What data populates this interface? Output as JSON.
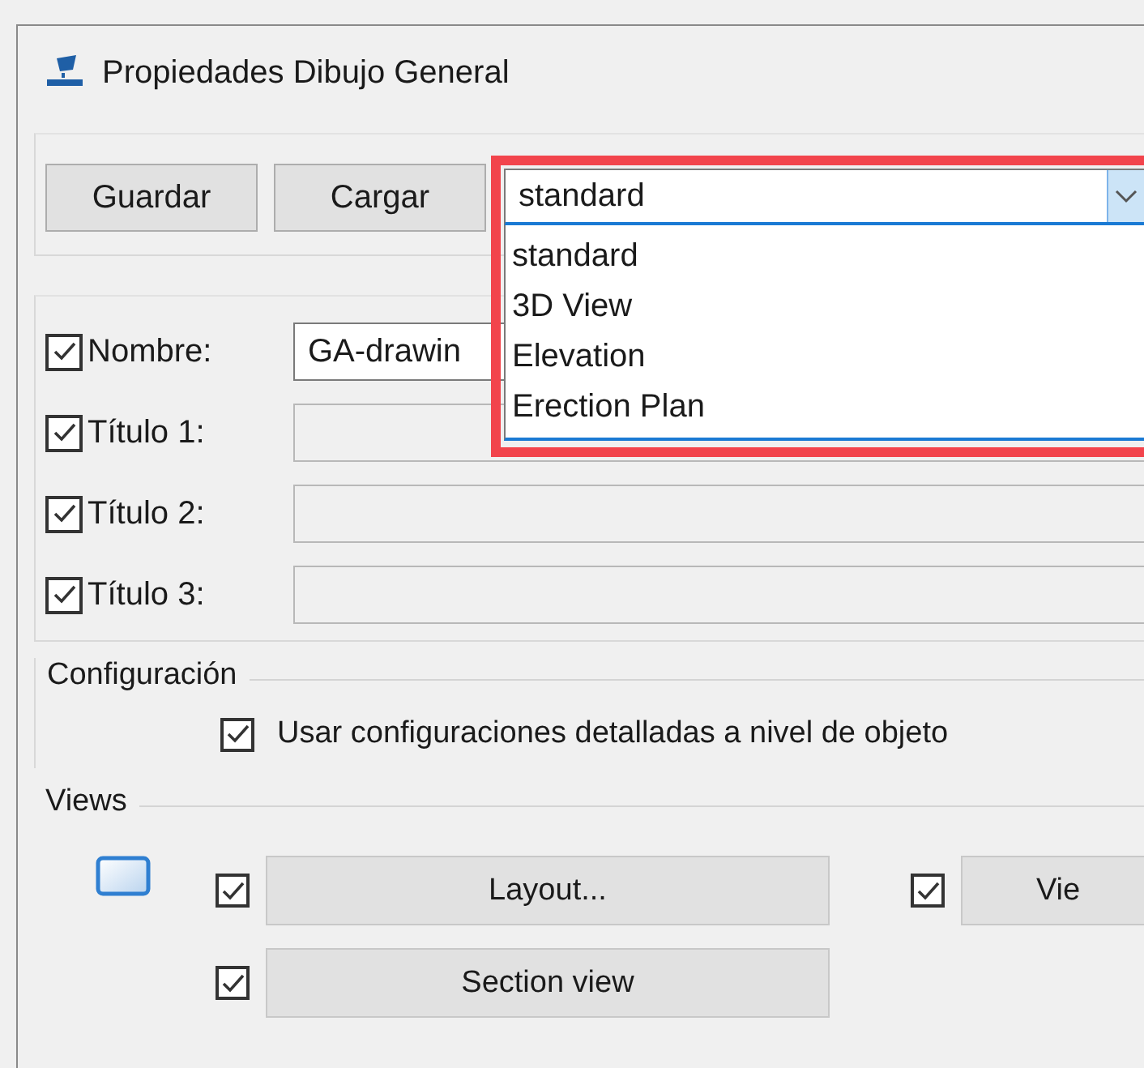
{
  "window": {
    "title": "Propiedades Dibujo General"
  },
  "toolbar": {
    "buttons": [
      "Guardar",
      "Cargar"
    ],
    "combo": {
      "value": "standard",
      "expanded": true,
      "options": [
        {
          "label": "standard"
        },
        {
          "label": "3D View"
        },
        {
          "label": "Elevation"
        },
        {
          "label": "Erection Plan"
        }
      ]
    }
  },
  "fields": [
    {
      "label": "Nombre:",
      "checked": true,
      "value": "GA-drawin",
      "disabled": false
    },
    {
      "label": "Título 1:",
      "checked": true,
      "disabled": true
    },
    {
      "label": "Título 2:",
      "checked": true,
      "disabled": true
    },
    {
      "label": "Título 3:",
      "checked": true,
      "disabled": true
    }
  ],
  "configuracion": {
    "title": "Configuración",
    "option": {
      "label": "Usar configuraciones detalladas a nivel de objeto",
      "checked": true
    }
  },
  "views": {
    "title": "Views",
    "rows": [
      [
        {
          "label": "Layout...",
          "checked": true
        },
        {
          "label": "Vie",
          "checked": true
        }
      ],
      [
        {
          "label": "Section view",
          "checked": true
        }
      ]
    ]
  }
}
